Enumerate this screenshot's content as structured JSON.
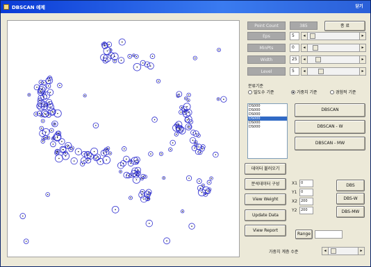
{
  "window": {
    "title": "DBSCAN 예제",
    "close_label": "닫기"
  },
  "stats": {
    "point_count_label": "Point Count",
    "point_count_value": "385",
    "action_label": "종 료",
    "params": [
      {
        "label": "Eps",
        "value": "5"
      },
      {
        "label": "MinPts",
        "value": "0"
      },
      {
        "label": "Width",
        "value": "25"
      },
      {
        "label": "Level",
        "value": "5"
      }
    ]
  },
  "criteria": {
    "group_label": "분류기준",
    "options": [
      {
        "label": "밀도수 기준",
        "selected": false
      },
      {
        "label": "가중치 기준",
        "selected": true
      },
      {
        "label": "경험적 기준",
        "selected": false
      }
    ]
  },
  "list_items": [
    "DS000",
    "DS000",
    "DS000",
    "DS000",
    "DS000",
    "DS000"
  ],
  "list_selected_index": 3,
  "algorithms": [
    "DBSCAN",
    "DBSCAN - W",
    "DBSCAN - MW"
  ],
  "actions": [
    "데이터 불러오기",
    "분석데이터 구성",
    "View Weight",
    "Update Data",
    "View Report"
  ],
  "coords": [
    {
      "label": "X1",
      "value": "0",
      "button": "DBS"
    },
    {
      "label": "Y1",
      "value": "0",
      "button": "DBS-W"
    },
    {
      "label": "X2",
      "value": "200",
      "button": "DBS-MW"
    },
    {
      "label": "Y2",
      "value": "200",
      "button": ""
    }
  ],
  "range_label": "Range",
  "footer_label": "가중치 계층 수준",
  "colors": {
    "marker": "#2f2fd0",
    "dot": "#222222",
    "selection": "#316ac5"
  }
}
